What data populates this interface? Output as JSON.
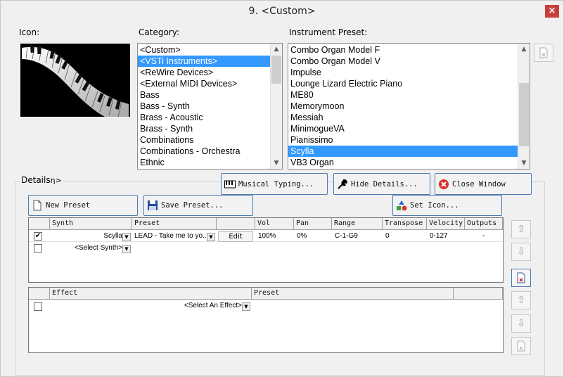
{
  "window": {
    "title": "9. <Custom>",
    "close_label": "×"
  },
  "labels": {
    "icon": "Icon:",
    "category": "Category:",
    "instrument_preset": "Instrument Preset:",
    "details": "Details",
    "details_suffix": "η>"
  },
  "category_list": {
    "items": [
      "<Custom>",
      "<VSTi Instruments>",
      "<ReWire Devices>",
      "<External MIDI Devices>",
      "Bass",
      "Bass - Synth",
      "Brass - Acoustic",
      "Brass - Synth",
      "Combinations",
      "Combinations - Orchestra",
      "Ethnic"
    ],
    "selected": "<VSTi Instruments>"
  },
  "preset_list": {
    "items": [
      "Combo Organ Model F",
      "Combo Organ Model V",
      "Impulse",
      "Lounge Lizard Electric Piano",
      "ME80",
      "Memorymoon",
      "Messiah",
      "MinimogueVA",
      "Pianissimo",
      "Scylla",
      "VB3 Organ"
    ],
    "selected": "Scylla"
  },
  "buttons": {
    "musical_typing": "Musical Typing...",
    "hide_details": "Hide Details...",
    "close_window": "Close Window",
    "new_preset": "New Preset",
    "save_preset": "Save Preset...",
    "set_icon": "Set Icon..."
  },
  "synth_table": {
    "headers": [
      "Synth",
      "Preset",
      "",
      "Vol",
      "Pan",
      "Range",
      "Transpose",
      "Velocity",
      "Outputs"
    ],
    "rows": [
      {
        "checked": true,
        "synth": "Scylla",
        "preset": "LEAD - Take me to yo...",
        "edit": "Edit",
        "vol": "100%",
        "pan": "0%",
        "range": "C-1-G9",
        "transpose": "0",
        "velocity": "0-127",
        "outputs": "-"
      }
    ],
    "empty_row": {
      "synth_placeholder": "<Select Synth>"
    }
  },
  "effect_table": {
    "headers": [
      "Effect",
      "Preset"
    ],
    "empty_row": {
      "effect_placeholder": "<Select An Effect>"
    }
  },
  "icons": {
    "checkmark": "✔",
    "up": "⇧",
    "down": "⇩"
  }
}
